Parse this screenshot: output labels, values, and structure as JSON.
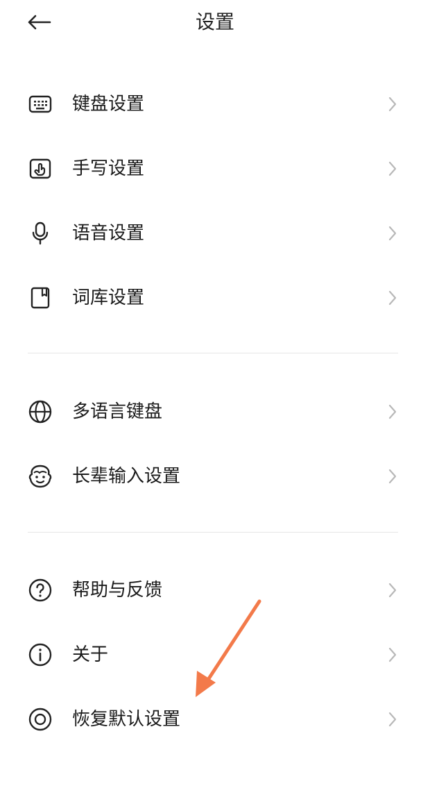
{
  "header": {
    "title": "设置",
    "back_icon": "arrow-left-icon"
  },
  "sections": [
    {
      "items": [
        {
          "label": "键盘设置",
          "icon": "keyboard-icon"
        },
        {
          "label": "手写设置",
          "icon": "handwriting-icon"
        },
        {
          "label": "语音设置",
          "icon": "microphone-icon"
        },
        {
          "label": "词库设置",
          "icon": "lexicon-icon"
        }
      ]
    },
    {
      "items": [
        {
          "label": "多语言键盘",
          "icon": "globe-icon"
        },
        {
          "label": "长辈输入设置",
          "icon": "elder-face-icon"
        }
      ]
    },
    {
      "items": [
        {
          "label": "帮助与反馈",
          "icon": "help-circle-icon"
        },
        {
          "label": "关于",
          "icon": "info-circle-icon"
        },
        {
          "label": "恢复默认设置",
          "icon": "reset-circle-icon"
        }
      ]
    }
  ],
  "colors": {
    "text": "#1a1a1a",
    "icon": "#222222",
    "chevron": "#b8b8b8",
    "divider": "#e6e6e6",
    "annotation_arrow": "#f37a4a"
  }
}
